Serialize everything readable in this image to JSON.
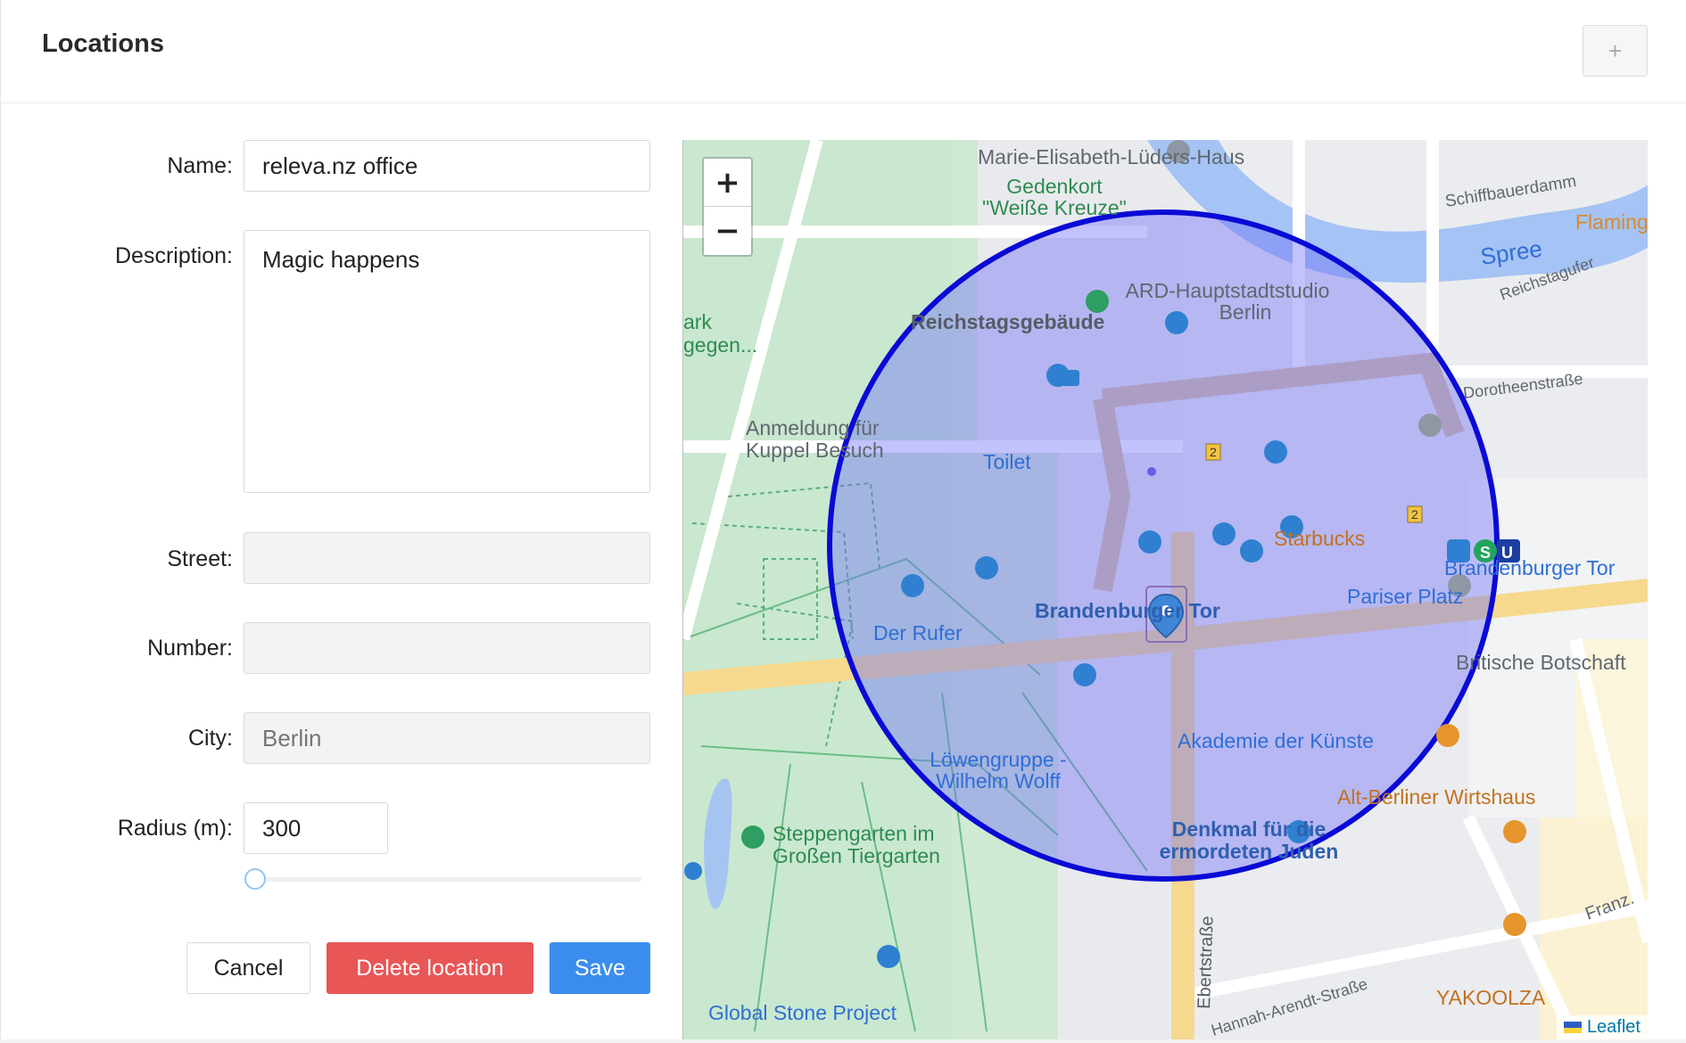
{
  "header": {
    "title": "Locations",
    "add_label": "+"
  },
  "form": {
    "name_label": "Name:",
    "name_value": "releva.nz office",
    "description_label": "Description:",
    "description_value": "Magic happens",
    "street_label": "Street:",
    "street_value": "",
    "number_label": "Number:",
    "number_value": "",
    "city_label": "City:",
    "city_placeholder": "Berlin",
    "radius_label": "Radius (m):",
    "radius_value": "300",
    "radius_slider_fraction": 0.0
  },
  "actions": {
    "cancel": "Cancel",
    "delete": "Delete location",
    "save": "Save"
  },
  "map": {
    "zoom_in": "+",
    "zoom_out": "−",
    "attribution": "Leaflet",
    "circle_color": "#1010e0",
    "labels": {
      "l1": "Marie-Elisabeth-Lüders-Haus",
      "l2": "Gedenkort",
      "l3": "\"Weiße Kreuze\"",
      "l4": "Schiffbauerdamm",
      "l5": "Flamingo",
      "l6": "Spree",
      "l7": "ARD-Hauptstadtstudio",
      "l8": "Berlin",
      "l9": "Reichstagufer",
      "l10": "Reichstagsgebäude",
      "l11": "ark",
      "l12": "gegen...",
      "l13": "Dorotheenstraße",
      "l14": "Anmeldung für",
      "l15": "Kuppel Besuch",
      "l16": "Toilet",
      "l17": "Starbucks",
      "l18": "Brandenburger Tor",
      "l19": "Pariser Platz",
      "l20": "Brandenburger Tor",
      "l21": "Der Rufer",
      "l22": "Britische Botschaft",
      "l23": "Akademie der Künste",
      "l24": "Löwengruppe -",
      "l25": "Wilhelm Wolff",
      "l26": "Alt-Berliner Wirtshaus",
      "l27": "Steppengarten im",
      "l28": "Großen Tiergarten",
      "l29": "Denkmal für die",
      "l30": "ermordeten Juden",
      "l31": "Ebertstraße",
      "l32": "Franz.",
      "l33": "Global Stone Project",
      "l34": "Hannah-Arendt-Straße",
      "l35": "YAKOOLZA",
      "l36": "2",
      "l37": "2",
      "l38": "S",
      "l39": "U"
    }
  }
}
